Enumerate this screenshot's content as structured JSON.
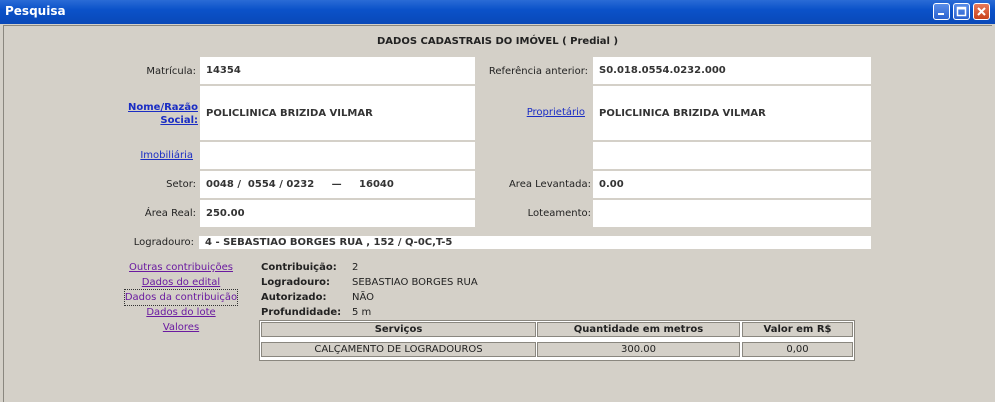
{
  "window": {
    "title": "Pesquisa"
  },
  "header": {
    "title": "DADOS CADASTRAIS DO IMÓVEL (  Predial  )"
  },
  "fields": {
    "matricula": {
      "label": "Matrícula:",
      "value": "14354"
    },
    "referencia": {
      "label": "Referência anterior:",
      "value": "S0.018.0554.0232.000"
    },
    "nome": {
      "label_line1": "Nome/Razão",
      "label_line2": "Social:",
      "value": "POLICLINICA BRIZIDA VILMAR"
    },
    "proprietario": {
      "label": "Proprietário",
      "value": "POLICLINICA BRIZIDA VILMAR"
    },
    "imobiliaria": {
      "label": "Imobiliária",
      "value": ""
    },
    "imobiliaria_right": {
      "value": ""
    },
    "setor": {
      "label": "Setor:",
      "value": "0048 /  0554 / 0232     —     16040"
    },
    "area_levantada": {
      "label": "Area Levantada:",
      "value": "0.00"
    },
    "area_real": {
      "label": "Área Real:",
      "value": "250.00"
    },
    "loteamento": {
      "label": "Loteamento:",
      "value": ""
    },
    "logradouro": {
      "label": "Logradouro:",
      "value": "4 - SEBASTIAO BORGES RUA , 152 / Q-0C,T-5"
    }
  },
  "side_links": [
    "Outras contribuições",
    "Dados do edital",
    "Dados da contribuição",
    "Dados do lote",
    "Valores"
  ],
  "contribution": {
    "contribuicao": {
      "label": "Contribuição:",
      "value": "2"
    },
    "logradouro": {
      "label": "Logradouro:",
      "value": "SEBASTIAO BORGES RUA"
    },
    "autorizado": {
      "label": "Autorizado:",
      "value": "NÃO"
    },
    "profundidade": {
      "label": "Profundidade:",
      "value": "5 m"
    }
  },
  "services_table": {
    "headers": [
      "Serviços",
      "Quantidade em metros",
      "Valor em R$"
    ],
    "rows": [
      [
        "CALÇAMENTO DE LOGRADOUROS",
        "300.00",
        "0,00"
      ]
    ]
  },
  "colors": {
    "titlebar": "#0b52c9",
    "background": "#d4d0c8",
    "link": "#1a2dc4",
    "visited_link": "#6a1aa0"
  }
}
